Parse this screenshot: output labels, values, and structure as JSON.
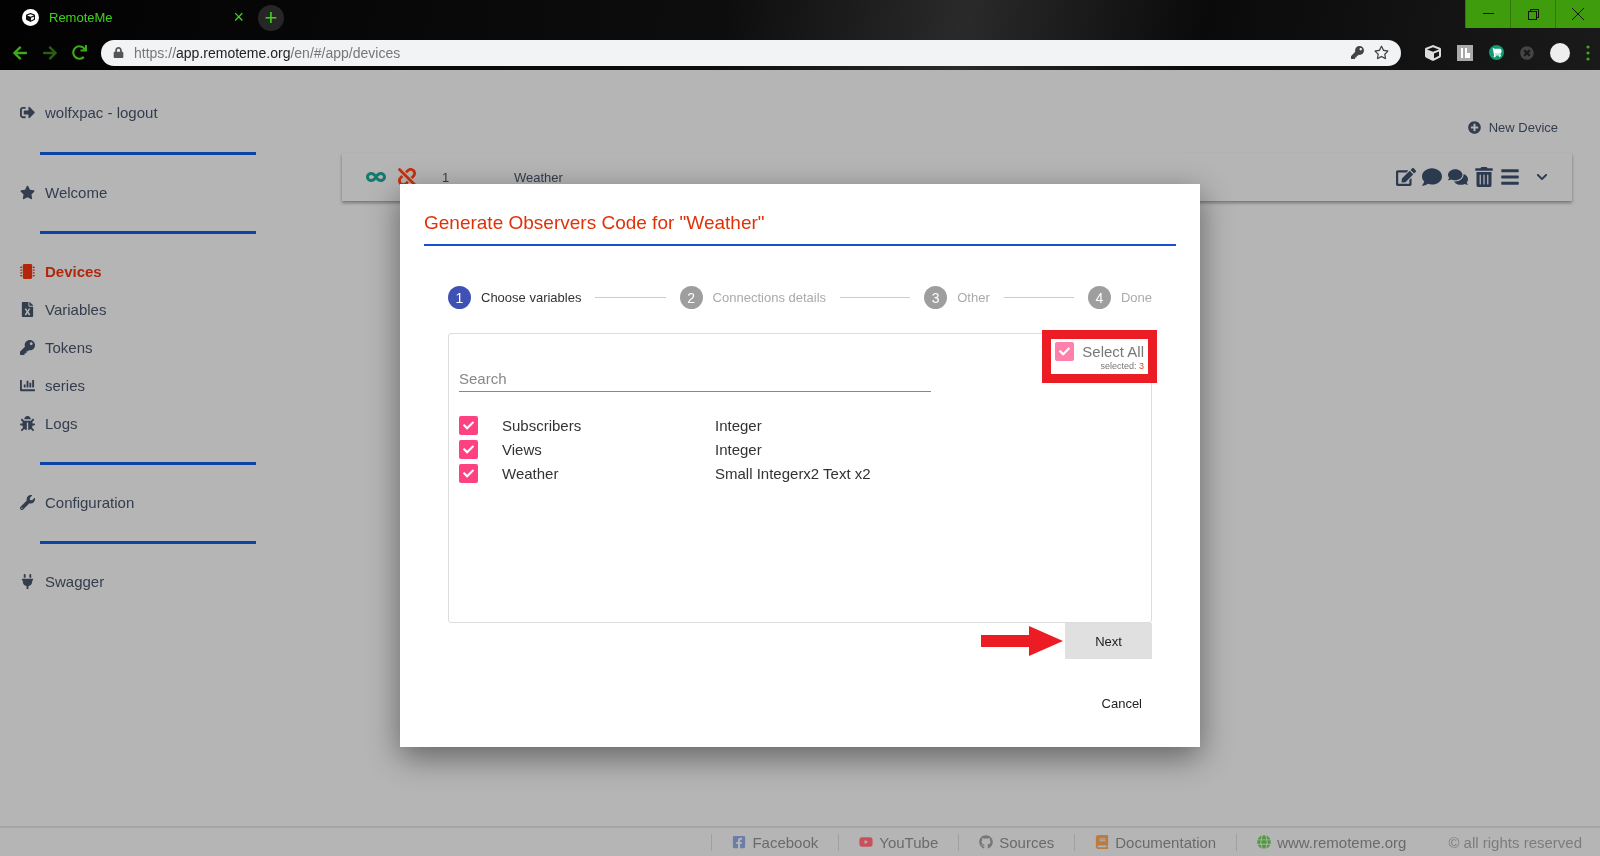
{
  "browser": {
    "tab": {
      "title": "RemoteMe",
      "close": "×"
    },
    "new_tab": "+",
    "url": {
      "scheme": "https://",
      "host": "app.remoteme.org",
      "path": "/en/#/app/devices"
    }
  },
  "sidebar": {
    "groups": [
      [
        {
          "label": "wolfxpac - logout",
          "selected": false
        }
      ],
      [
        {
          "label": "Welcome",
          "selected": false
        }
      ],
      [
        {
          "label": "Devices",
          "selected": true
        },
        {
          "label": "Variables",
          "selected": false
        },
        {
          "label": "Tokens",
          "selected": false
        },
        {
          "label": "series",
          "selected": false
        },
        {
          "label": "Logs",
          "selected": false
        }
      ],
      [
        {
          "label": "Configuration",
          "selected": false
        }
      ],
      [
        {
          "label": "Swagger",
          "selected": false
        }
      ]
    ]
  },
  "new_device": "New Device",
  "device": {
    "id": "1",
    "name": "Weather",
    "connected": false
  },
  "dialog": {
    "title": "Generate Observers Code for \"Weather\"",
    "steps": [
      {
        "number": "1",
        "label": "Choose variables",
        "selected": true
      },
      {
        "number": "2",
        "label": "Connections details",
        "selected": false
      },
      {
        "number": "3",
        "label": "Other",
        "selected": false
      },
      {
        "number": "4",
        "label": "Done",
        "selected": false
      }
    ],
    "search": {
      "placeholder": "Search"
    },
    "select_all": {
      "label": "Select All",
      "checked": true,
      "selected_label": "selected:",
      "selected_count": "3"
    },
    "variables": [
      {
        "name": "Subscribers",
        "type": "Integer",
        "checked": true
      },
      {
        "name": "Views",
        "type": "Integer",
        "checked": true
      },
      {
        "name": "Weather",
        "type": "Small Integerx2 Text x2",
        "checked": true
      }
    ],
    "next": "Next",
    "cancel": "Cancel"
  },
  "footer": [
    "Facebook",
    "YouTube",
    "Sources",
    "Documentation",
    "www.remoteme.org",
    "© all rights reserved"
  ]
}
